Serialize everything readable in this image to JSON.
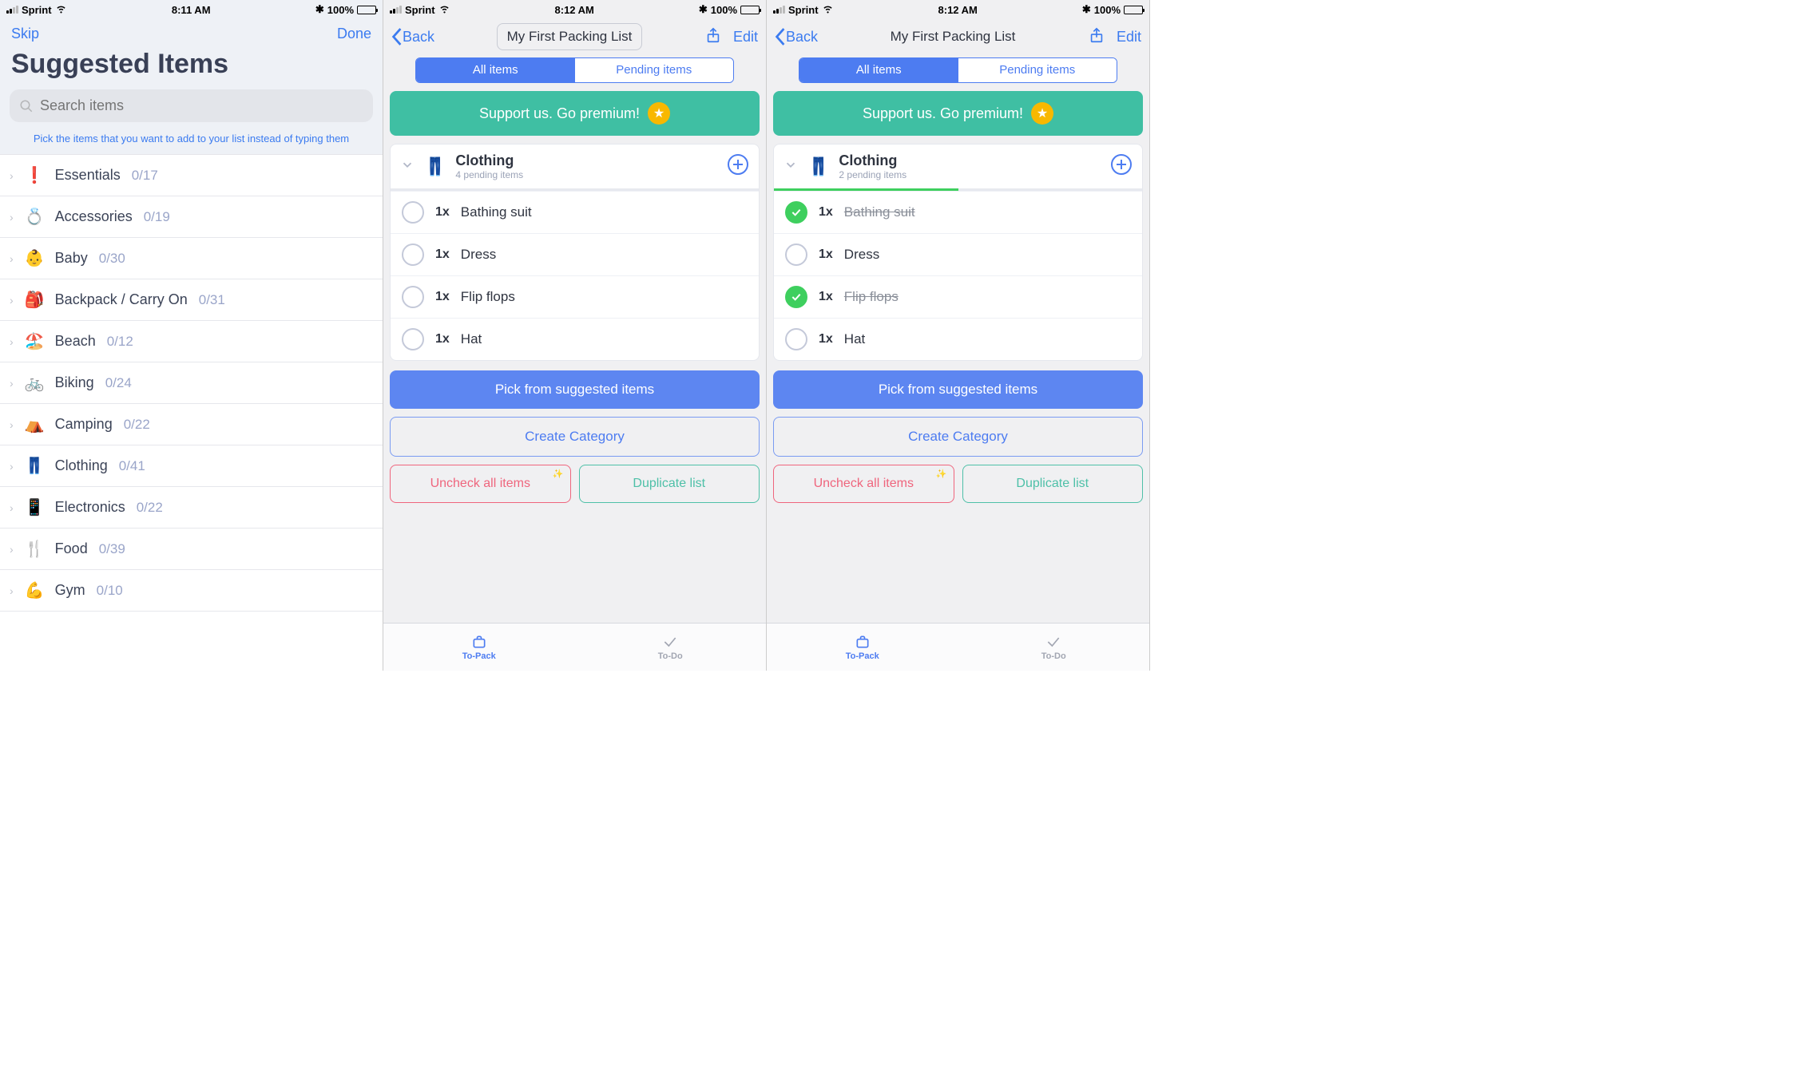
{
  "status": {
    "carrier": "Sprint",
    "time1": "8:11 AM",
    "time2": "8:12 AM",
    "time3": "8:12 AM",
    "bluetooth": "✱",
    "battery": "100%"
  },
  "screen1": {
    "nav": {
      "skip": "Skip",
      "done": "Done"
    },
    "title": "Suggested Items",
    "search_placeholder": "Search items",
    "hint": "Pick the items that you want to add to your list instead of typing them",
    "categories": [
      {
        "emoji": "❗",
        "name": "Essentials",
        "count": "0/17"
      },
      {
        "emoji": "💍",
        "name": "Accessories",
        "count": "0/19"
      },
      {
        "emoji": "👶",
        "name": "Baby",
        "count": "0/30"
      },
      {
        "emoji": "🎒",
        "name": "Backpack / Carry On",
        "count": "0/31"
      },
      {
        "emoji": "🏖️",
        "name": "Beach",
        "count": "0/12"
      },
      {
        "emoji": "🚲",
        "name": "Biking",
        "count": "0/24"
      },
      {
        "emoji": "⛺",
        "name": "Camping",
        "count": "0/22"
      },
      {
        "emoji": "👖",
        "name": "Clothing",
        "count": "0/41"
      },
      {
        "emoji": "📱",
        "name": "Electronics",
        "count": "0/22"
      },
      {
        "emoji": "🍴",
        "name": "Food",
        "count": "0/39"
      },
      {
        "emoji": "💪",
        "name": "Gym",
        "count": "0/10"
      }
    ]
  },
  "list": {
    "back": "Back",
    "title": "My First Packing List",
    "edit": "Edit",
    "seg_all": "All items",
    "seg_pending": "Pending items",
    "promo": "Support us. Go premium!",
    "group": {
      "emoji": "👖",
      "title": "Clothing"
    },
    "pick_btn": "Pick from suggested items",
    "create_btn": "Create Category",
    "uncheck_btn": "Uncheck all items",
    "dup_btn": "Duplicate list",
    "tab_pack": "To-Pack",
    "tab_todo": "To-Do"
  },
  "screen2": {
    "pending_sub": "4 pending items",
    "progress_pct": "0%",
    "items": [
      {
        "qty": "1x",
        "name": "Bathing suit",
        "done": false
      },
      {
        "qty": "1x",
        "name": "Dress",
        "done": false
      },
      {
        "qty": "1x",
        "name": "Flip flops",
        "done": false
      },
      {
        "qty": "1x",
        "name": "Hat",
        "done": false
      }
    ]
  },
  "screen3": {
    "pending_sub": "2 pending items",
    "progress_pct": "50%",
    "items": [
      {
        "qty": "1x",
        "name": "Bathing suit",
        "done": true
      },
      {
        "qty": "1x",
        "name": "Dress",
        "done": false
      },
      {
        "qty": "1x",
        "name": "Flip flops",
        "done": true
      },
      {
        "qty": "1x",
        "name": "Hat",
        "done": false
      }
    ]
  }
}
